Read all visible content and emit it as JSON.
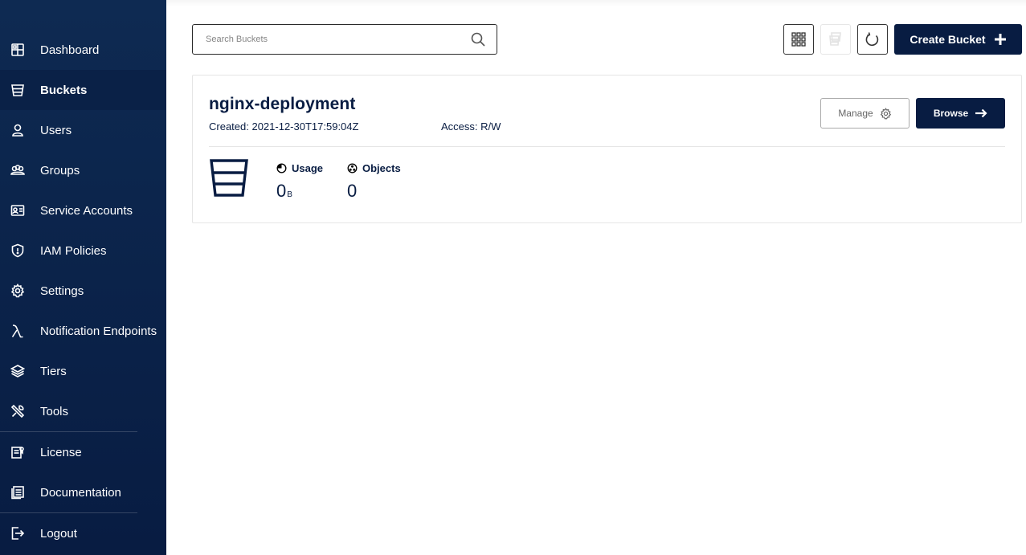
{
  "sidebar": {
    "items": [
      {
        "label": "Dashboard",
        "icon": "dashboard-icon",
        "active": false
      },
      {
        "label": "Buckets",
        "icon": "bucket-icon",
        "active": true
      },
      {
        "label": "Users",
        "icon": "user-icon",
        "active": false
      },
      {
        "label": "Groups",
        "icon": "groups-icon",
        "active": false
      },
      {
        "label": "Service Accounts",
        "icon": "id-card-icon",
        "active": false
      },
      {
        "label": "IAM Policies",
        "icon": "shield-icon",
        "active": false
      },
      {
        "label": "Settings",
        "icon": "gear-icon",
        "active": false
      },
      {
        "label": "Notification Endpoints",
        "icon": "lambda-icon",
        "active": false
      },
      {
        "label": "Tiers",
        "icon": "layers-icon",
        "active": false
      },
      {
        "label": "Tools",
        "icon": "tools-icon",
        "active": false
      },
      {
        "label": "License",
        "icon": "license-icon",
        "active": false
      },
      {
        "label": "Documentation",
        "icon": "documentation-icon",
        "active": false
      },
      {
        "label": "Logout",
        "icon": "logout-icon",
        "active": false
      }
    ]
  },
  "toolbar": {
    "search_placeholder": "Search Buckets",
    "create_label": "Create Bucket"
  },
  "bucket": {
    "name": "nginx-deployment",
    "created": "Created: 2021-12-30T17:59:04Z",
    "access": "Access: R/W",
    "manage_label": "Manage",
    "browse_label": "Browse",
    "usage_label": "Usage",
    "usage_value": "0",
    "usage_unit": "B",
    "objects_label": "Objects",
    "objects_value": "0"
  },
  "colors": {
    "brand_navy": "#081c42",
    "sidebar_top": "#0e2a52",
    "border": "#e5e5e5"
  }
}
